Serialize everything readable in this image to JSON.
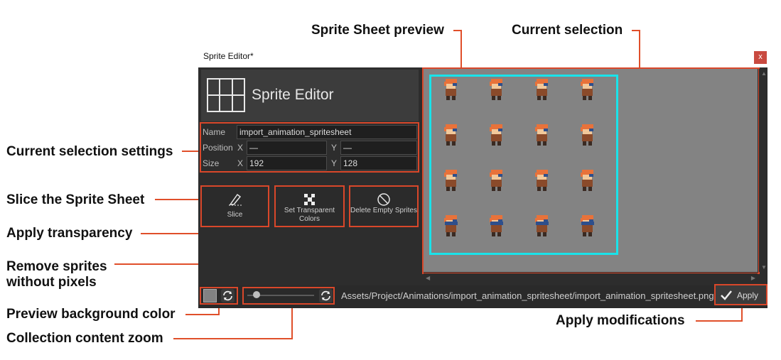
{
  "window": {
    "title": "Sprite Editor*",
    "close_label": "x"
  },
  "header": {
    "title": "Sprite Editor"
  },
  "fields": {
    "name_label": "Name",
    "name_value": "import_animation_spritesheet",
    "position_label": "Position",
    "x_label": "X",
    "y_label": "Y",
    "pos_x": "—",
    "pos_y": "—",
    "size_label": "Size",
    "size_x": "192",
    "size_y": "128"
  },
  "tools": {
    "slice_label": "Slice",
    "transparent_label": "Set Transparent Colors",
    "delete_label": "Delete Empty Sprites"
  },
  "bottom": {
    "path": "Assets/Project/Animations/import_animation_spritesheet/import_animation_spritesheet.png",
    "apply_label": "Apply",
    "zoom_level": 0.1
  },
  "callouts": {
    "preview": "Sprite Sheet preview",
    "selection": "Current selection",
    "settings": "Current selection settings",
    "slice": "Slice the Sprite Sheet",
    "transparency": "Apply transparency",
    "remove_1": "Remove sprites",
    "remove_2": "without pixels",
    "bg_color": "Preview background color",
    "zoom": "Collection content zoom",
    "apply": "Apply modifications"
  },
  "colors": {
    "accent_annotation": "#d9472a",
    "selection": "#19e3ea",
    "preview_bg": "#838383"
  },
  "sprites": {
    "rows": 4,
    "cols": 4
  }
}
